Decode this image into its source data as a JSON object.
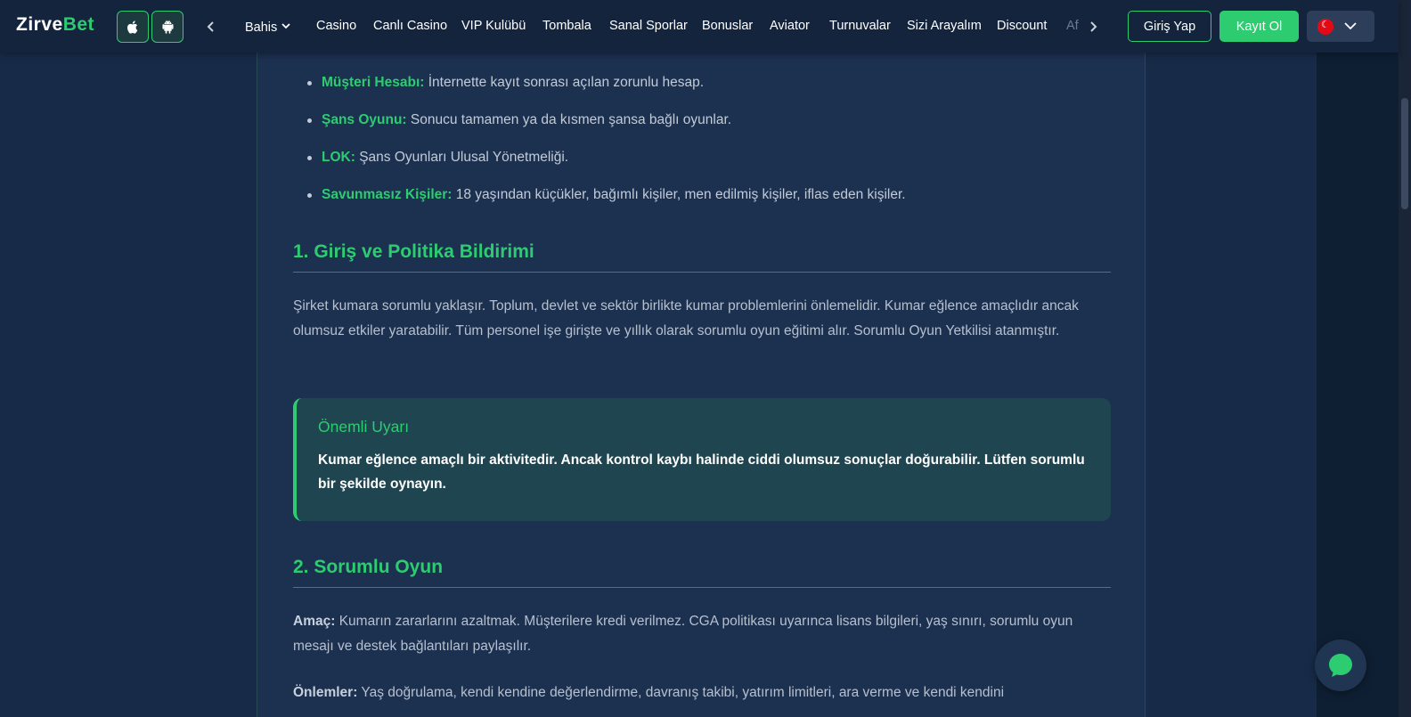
{
  "brand": {
    "logo_main": "Zirve",
    "logo_accent": "Bet"
  },
  "header": {
    "nav": [
      {
        "label": "Bahis",
        "dropdown": true
      },
      {
        "label": "Casino"
      },
      {
        "label": "Canlı Casino"
      },
      {
        "label": "VIP Kulübü"
      },
      {
        "label": "Tombala"
      },
      {
        "label": "Sanal Sporlar"
      },
      {
        "label": "Bonuslar"
      },
      {
        "label": "Aviator"
      },
      {
        "label": "Turnuvalar"
      },
      {
        "label": "Sizi Arayalım"
      },
      {
        "label": "Discount"
      },
      {
        "label": "Af"
      }
    ],
    "login_label": "Giriş Yap",
    "register_label": "Kayıt Ol",
    "language_icon": "turkey-flag-icon"
  },
  "definitions": [
    {
      "term": "Müşteri Hesabı:",
      "desc": " İnternette kayıt sonrası açılan zorunlu hesap."
    },
    {
      "term": "Şans Oyunu:",
      "desc": " Sonucu tamamen ya da kısmen şansa bağlı oyunlar."
    },
    {
      "term": "LOK:",
      "desc": " Şans Oyunları Ulusal Yönetmeliği."
    },
    {
      "term": "Savunmasız Kişiler:",
      "desc": " 18 yaşından küçükler, bağımlı kişiler, men edilmiş kişiler, iflas eden kişiler."
    }
  ],
  "section1": {
    "title": "1. Giriş ve Politika Bildirimi",
    "body": "Şirket kumara sorumlu yaklaşır. Toplum, devlet ve sektör birlikte kumar problemlerini önlemelidir. Kumar eğlence amaçlıdır ancak olumsuz etkiler yaratabilir. Tüm personel işe girişte ve yıllık olarak sorumlu oyun eğitimi alır. Sorumlu Oyun Yetkilisi atanmıştır."
  },
  "warning": {
    "title": "Önemli Uyarı",
    "text": "Kumar eğlence amaçlı bir aktivitedir. Ancak kontrol kaybı halinde ciddi olumsuz sonuçlar doğurabilir. Lütfen sorumlu bir şekilde oynayın."
  },
  "section2": {
    "title": "2. Sorumlu Oyun",
    "aim_label": "Amaç:",
    "aim_text": " Kumarın zararlarını azaltmak. Müşterilere kredi verilmez. CGA politikası uyarınca lisans bilgileri, yaş sınırı, sorumlu oyun mesajı ve destek bağlantıları paylaşılır.",
    "measures_label": "Önlemler:",
    "measures_text": " Yaş doğrulama, kendi kendine değerlendirme, davranış takibi, yatırım limitleri, ara verme ve kendi kendini"
  },
  "colors": {
    "accent": "#2ecc71",
    "header_bg": "#14243d",
    "content_bg": "#1c3050"
  }
}
